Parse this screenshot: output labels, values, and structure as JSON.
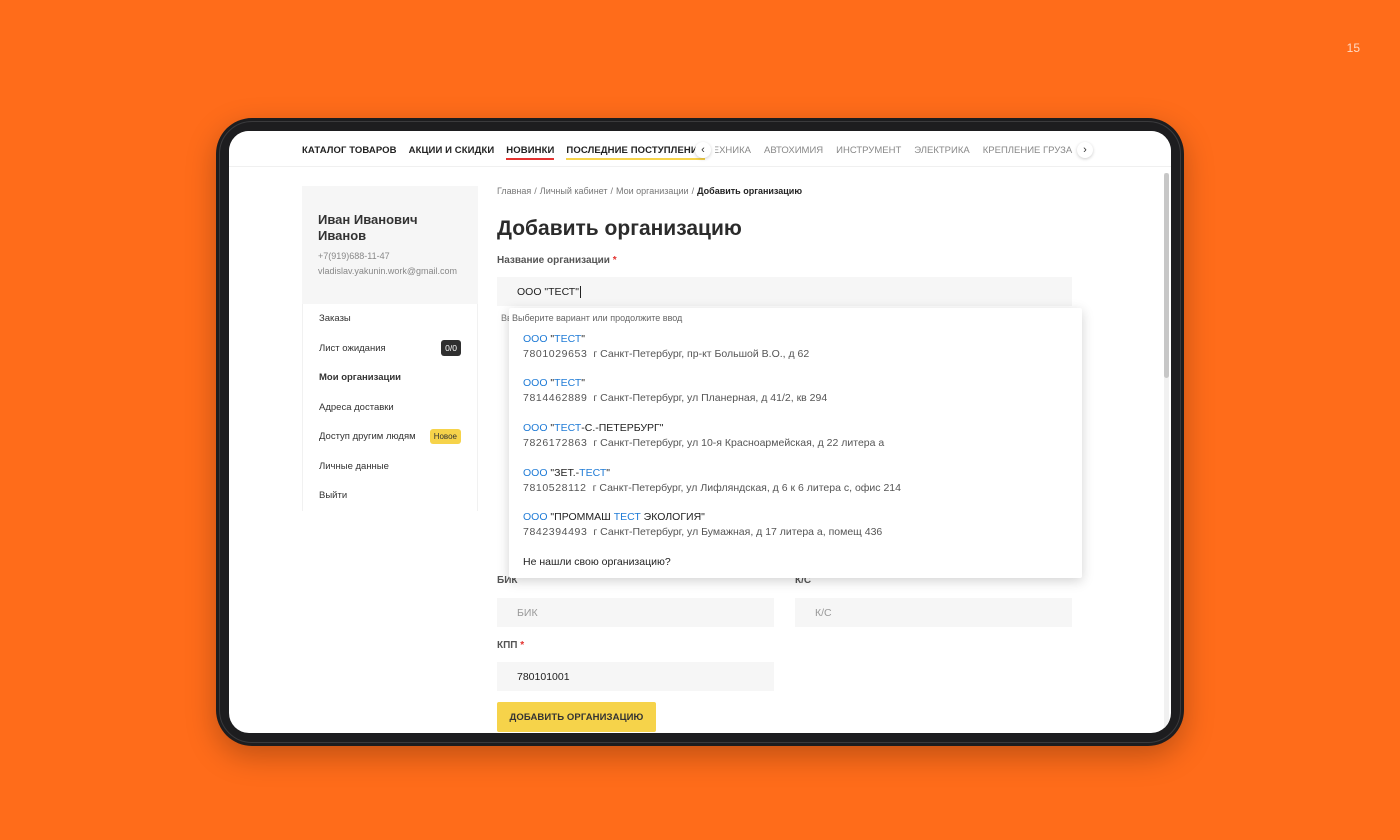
{
  "slide_number": "15",
  "topnav": {
    "main_links": [
      "КАТАЛОГ ТОВАРОВ",
      "АКЦИИ И СКИДКИ",
      "НОВИНКИ",
      "ПОСЛЕДНИЕ ПОСТУПЛЕНИЯ"
    ],
    "categories": [
      "ЭЛЕКТРОТЕХНИКА",
      "АВТОХИМИЯ",
      "ИНСТРУМЕНТ",
      "ЭЛЕКТРИКА",
      "КРЕПЛЕНИЕ ГРУЗА"
    ]
  },
  "profile": {
    "name": "Иван Иванович Иванов",
    "phone": "+7(919)688-11-47",
    "email": "vladislav.yakunin.work@gmail.com"
  },
  "menu": {
    "orders": "Заказы",
    "wishlist": "Лист ожидания",
    "wishlist_badge": "0/0",
    "organizations": "Мои организации",
    "addresses": "Адреса доставки",
    "access": "Доступ другим людям",
    "access_badge": "Новое",
    "personal": "Личные данные",
    "logout": "Выйти"
  },
  "breadcrumb": [
    "Главная",
    "Личный кабинет",
    "Мои организации",
    "Добавить организацию"
  ],
  "page_title": "Добавить организацию",
  "form": {
    "org_label": "Название организации",
    "org_value": "ООО \"ТЕСТ\"",
    "hint_fragment": "Вв",
    "bik_label": "БИК",
    "bik_placeholder": "БИК",
    "ks_label": "К/С",
    "ks_placeholder": "К/С",
    "kpp_label": "КПП",
    "kpp_value": "780101001",
    "submit_label": "ДОБАВИТЬ ОРГАНИЗАЦИЮ"
  },
  "suggestions": {
    "hint": "Выберите вариант или продолжите ввод",
    "items": [
      {
        "prefix": "ООО",
        "name_before": " \"",
        "name_hl": "ТЕСТ",
        "name_after": "\"",
        "inn": "7801029653",
        "address": "г Санкт-Петербург, пр-кт Большой В.О., д 62"
      },
      {
        "prefix": "ООО",
        "name_before": " \"",
        "name_hl": "ТЕСТ",
        "name_after": "\"",
        "inn": "7814462889",
        "address": "г Санкт-Петербург, ул Планерная, д 41/2, кв 294"
      },
      {
        "prefix": "ООО",
        "name_before": " \"",
        "name_hl": "ТЕСТ",
        "name_after": "-С.-ПЕТЕРБУРГ\"",
        "inn": "7826172863",
        "address": "г Санкт-Петербург, ул 10-я Красноармейская, д 22 литера а"
      },
      {
        "prefix": "ООО",
        "name_before": " \"ЗЕТ.-",
        "name_hl": "ТЕСТ",
        "name_after": "\"",
        "inn": "7810528112",
        "address": "г Санкт-Петербург, ул Лифляндская, д 6 к 6 литера с, офис 214"
      },
      {
        "prefix": "ООО",
        "name_before": " \"ПРОММАШ ",
        "name_hl": "ТЕСТ",
        "name_after": " ЭКОЛОГИЯ\"",
        "inn": "7842394493",
        "address": "г Санкт-Петербург, ул Бумажная, д 17 литера а, помещ 436"
      }
    ],
    "not_found": "Не нашли свою организацию?"
  }
}
